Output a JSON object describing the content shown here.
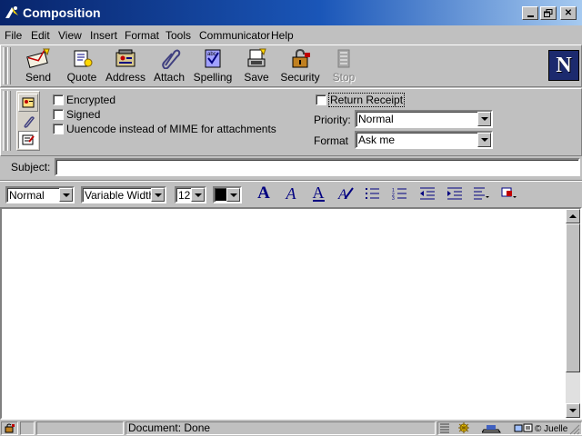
{
  "window": {
    "title": "Composition"
  },
  "menu": [
    {
      "label": "File"
    },
    {
      "label": "Edit"
    },
    {
      "label": "View"
    },
    {
      "label": "Insert"
    },
    {
      "label": "Format"
    },
    {
      "label": "Tools"
    },
    {
      "label": "Communicator"
    },
    {
      "label": "Help"
    }
  ],
  "toolbar": {
    "send": "Send",
    "quote": "Quote",
    "address": "Address",
    "attach": "Attach",
    "spelling": "Spelling",
    "save": "Save",
    "security": "Security",
    "stop": "Stop"
  },
  "options": {
    "encrypted": {
      "label": "Encrypted",
      "checked": false
    },
    "signed": {
      "label": "Signed",
      "checked": false
    },
    "uuencode": {
      "label": "Uuencode instead of MIME for attachments",
      "checked": false
    },
    "return_receipt": {
      "label": "Return Receipt",
      "checked": false
    },
    "priority_label": "Priority:",
    "priority_value": "Normal",
    "format_label": "Format",
    "format_value": "Ask me"
  },
  "subject": {
    "label": "Subject:",
    "value": ""
  },
  "format_bar": {
    "paragraph_style": "Normal",
    "font": "Variable Width",
    "size": "12",
    "text_color": "#000000"
  },
  "status": {
    "text": "Document: Done",
    "credit": "© Juelle"
  },
  "colors": {
    "title_start": "#08246b",
    "title_end": "#a6caf0",
    "face": "#c0c0c0",
    "logo_bg": "#1c2a6e"
  },
  "icons": [
    "send-icon",
    "quote-icon",
    "address-icon",
    "attach-icon",
    "spelling-icon",
    "save-icon",
    "security-icon",
    "stop-icon",
    "netscape-logo"
  ]
}
